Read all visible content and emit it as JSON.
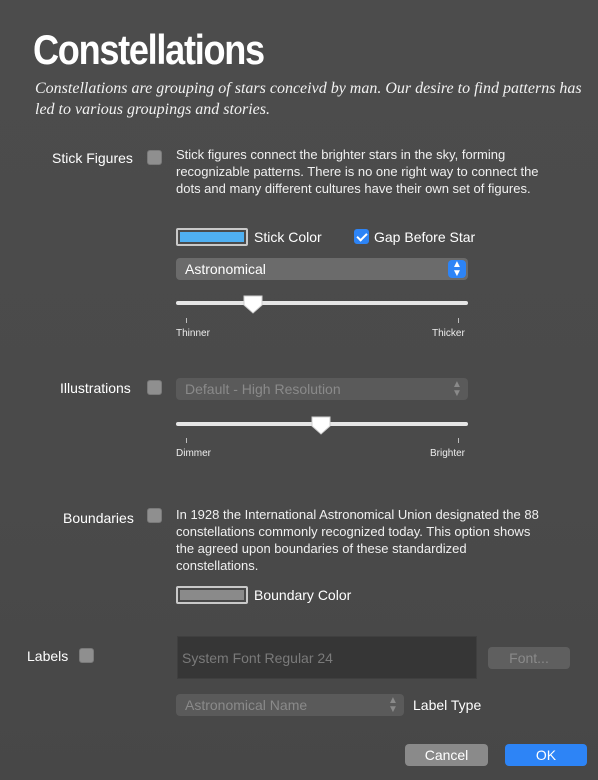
{
  "header": {
    "title": "Constellations",
    "subtitle": "Constellations are grouping of stars conceivd by man. Our desire to find patterns has led to various groupings and stories."
  },
  "stick_figures": {
    "label": "Stick Figures",
    "checked": false,
    "description": "Stick figures connect the brighter stars in the sky, forming recognizable patterns. There is no one right way to connect the dots and many different cultures have their own set of figures.",
    "color_label": "Stick Color",
    "color": "#4fb0f2",
    "gap_label": "Gap Before Star",
    "gap_checked": true,
    "style_select": "Astronomical",
    "thickness_value": 0.27,
    "thickness_min_label": "Thinner",
    "thickness_max_label": "Thicker"
  },
  "illustrations": {
    "label": "Illustrations",
    "checked": false,
    "select": "Default - High Resolution",
    "brightness_value": 0.5,
    "brightness_min_label": "Dimmer",
    "brightness_max_label": "Brighter"
  },
  "boundaries": {
    "label": "Boundaries",
    "checked": false,
    "description": "In 1928 the International Astronomical Union designated the 88 constellations commonly recognized today. This option shows the agreed upon boundaries of these standardized constellations.",
    "color_label": "Boundary Color",
    "color": "#8a8a8a"
  },
  "labels": {
    "label": "Labels",
    "checked": false,
    "font_display": "System Font Regular 24",
    "font_button": "Font...",
    "type_select": "Astronomical Name",
    "type_label": "Label Type"
  },
  "footer": {
    "cancel": "Cancel",
    "ok": "OK"
  },
  "colors": {
    "accent": "#2d84f6",
    "background": "#4a4a4a"
  }
}
